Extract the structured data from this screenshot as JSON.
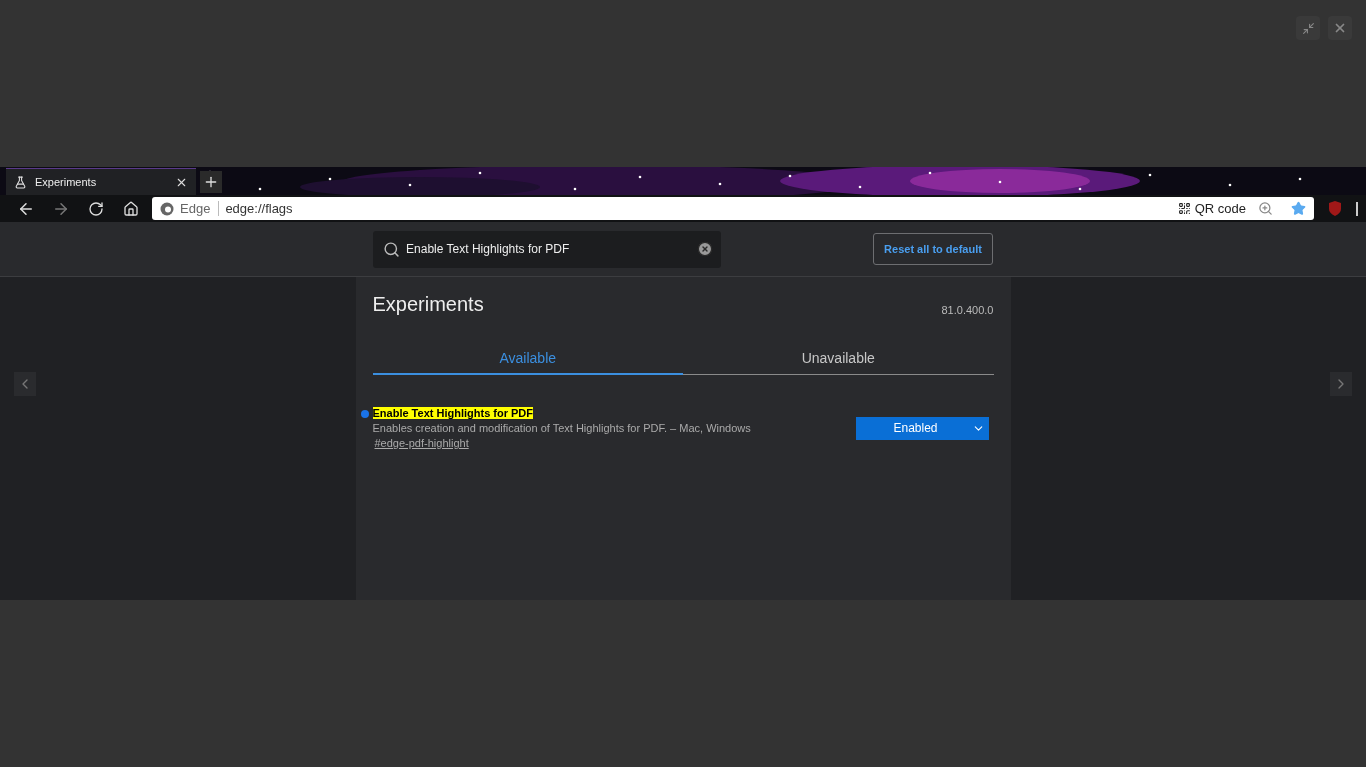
{
  "browser": {
    "tab": {
      "title": "Experiments"
    },
    "address": {
      "site_label": "Edge",
      "url": "edge://flags"
    },
    "qr_button": "QR code"
  },
  "flags_page": {
    "search": {
      "value": "Enable Text Highlights for PDF"
    },
    "reset_button": "Reset all to default",
    "title": "Experiments",
    "version": "81.0.400.0",
    "tabs": [
      {
        "label": "Available",
        "selected": true
      },
      {
        "label": "Unavailable",
        "selected": false
      }
    ],
    "flags": [
      {
        "name": "Enable Text Highlights for PDF",
        "description": "Enables creation and modification of Text Highlights for PDF. – Mac, Windows",
        "link": "#edge-pdf-highlight",
        "value": "Enabled",
        "modified": true
      }
    ]
  }
}
